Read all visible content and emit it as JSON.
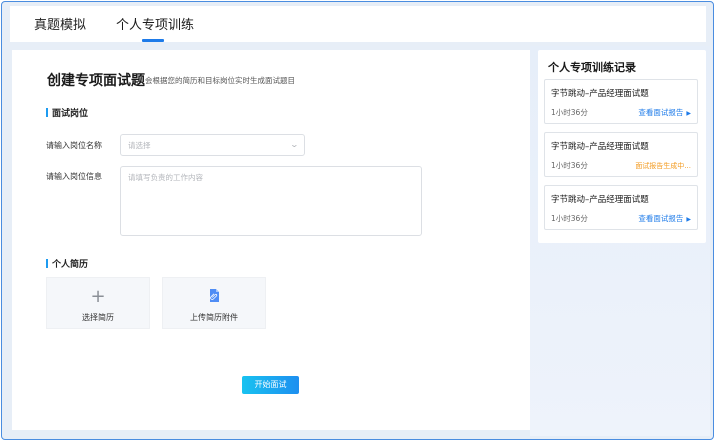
{
  "tabs": [
    {
      "label": "真题模拟"
    },
    {
      "label": "个人专项训练"
    }
  ],
  "form": {
    "title": "创建专项面试题",
    "subtitle": "会根据您的简历和目标岗位实时生成面试题目",
    "section_position": "面试岗位",
    "position_name_label": "请输入岗位名称",
    "position_name_placeholder": "请选择",
    "position_info_label": "请输入岗位信息",
    "position_info_placeholder": "请填写负责的工作内容",
    "section_resume": "个人简历",
    "select_resume": "选择简历",
    "upload_resume": "上传简历附件",
    "start_button": "开始面试"
  },
  "records": {
    "title": "个人专项训练记录",
    "items": [
      {
        "title": "字节跳动–产品经理面试题",
        "duration": "1小时36分",
        "action": "查看面试报告",
        "status": "link"
      },
      {
        "title": "字节跳动–产品经理面试题",
        "duration": "1小时36分",
        "action": "面试报告生成中...",
        "status": "pending"
      },
      {
        "title": "字节跳动–产品经理面试题",
        "duration": "1小时36分",
        "action": "查看面试报告",
        "status": "link"
      }
    ]
  },
  "colors": {
    "accent": "#1e7be9",
    "pending": "#f39a1e",
    "section_bar": "#1e9bf0"
  },
  "icons": {
    "add": "plus-icon",
    "upload": "file-attachment-icon",
    "chevron": "chevron-down-icon",
    "arrow": "triangle-right-icon"
  }
}
